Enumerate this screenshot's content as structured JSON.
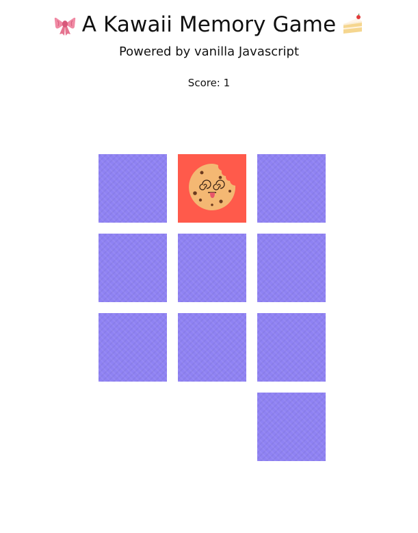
{
  "header": {
    "title": "A Kawaii Memory Game",
    "title_left_icon": "ribbon-bow-icon",
    "title_right_icon": "cake-slice-icon",
    "subtitle": "Powered by vanilla Javascript"
  },
  "score": {
    "label": "Score: 1"
  },
  "board": {
    "cards": [
      {
        "state": "face-down"
      },
      {
        "state": "face-up",
        "icon": "cookie-icon"
      },
      {
        "state": "face-down"
      },
      {
        "state": "face-down"
      },
      {
        "state": "face-down"
      },
      {
        "state": "face-down"
      },
      {
        "state": "face-down"
      },
      {
        "state": "face-down"
      },
      {
        "state": "face-down"
      },
      {
        "state": "empty"
      },
      {
        "state": "empty"
      },
      {
        "state": "face-down"
      }
    ]
  },
  "colors": {
    "card_back": "#8f82f3",
    "card_front": "#ff5a4b",
    "cookie": "#f4b873"
  }
}
